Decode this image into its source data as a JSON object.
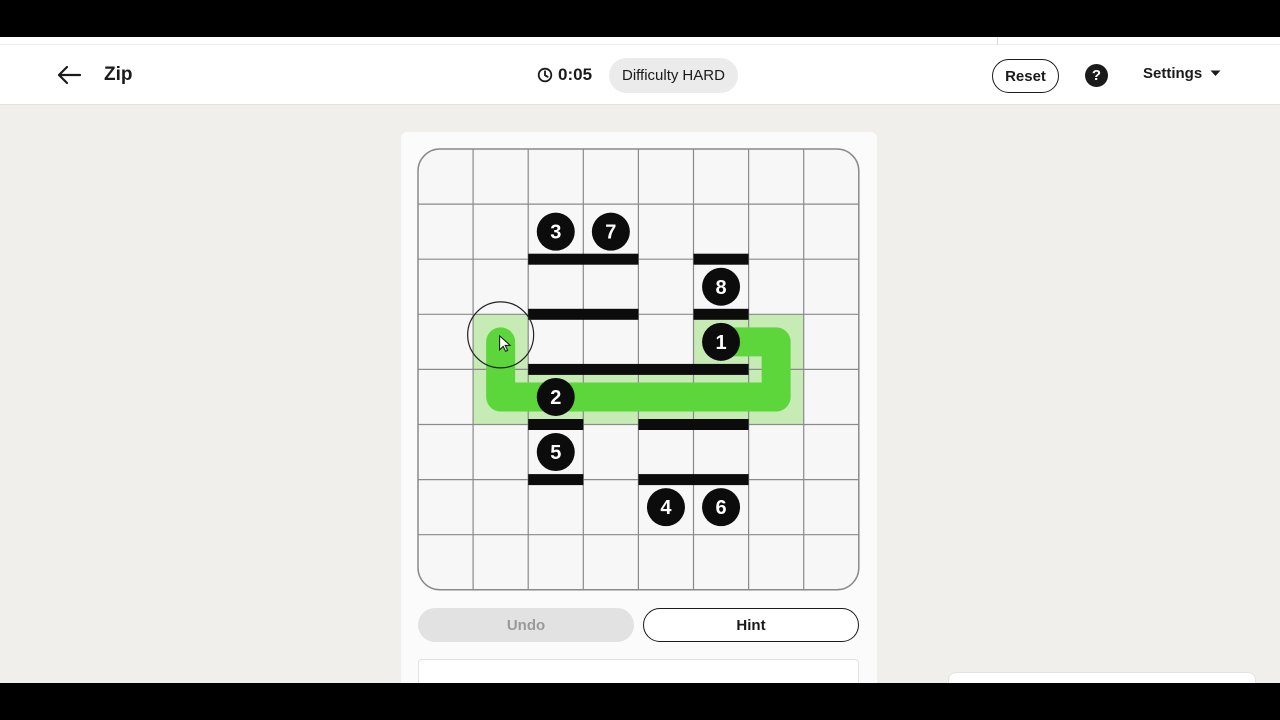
{
  "header": {
    "title": "Zip",
    "timer": "0:05",
    "difficulty_label": "Difficulty",
    "difficulty_value": "HARD",
    "reset_label": "Reset",
    "help_label": "?",
    "settings_label": "Settings"
  },
  "actions": {
    "undo_label": "Undo",
    "hint_label": "Hint"
  },
  "board": {
    "rows": 8,
    "cols": 8,
    "numbers": [
      {
        "label": "3",
        "row": 1,
        "col": 2
      },
      {
        "label": "7",
        "row": 1,
        "col": 3
      },
      {
        "label": "8",
        "row": 2,
        "col": 5
      },
      {
        "label": "1",
        "row": 3,
        "col": 5
      },
      {
        "label": "2",
        "row": 4,
        "col": 2
      },
      {
        "label": "5",
        "row": 5,
        "col": 2
      },
      {
        "label": "4",
        "row": 6,
        "col": 4
      },
      {
        "label": "6",
        "row": 6,
        "col": 5
      }
    ],
    "walls": [
      {
        "row": 2,
        "col_from": 2,
        "col_to": 3,
        "edge": "top"
      },
      {
        "row": 2,
        "col_from": 5,
        "col_to": 5,
        "edge": "top"
      },
      {
        "row": 3,
        "col_from": 2,
        "col_to": 3,
        "edge": "top"
      },
      {
        "row": 3,
        "col_from": 5,
        "col_to": 5,
        "edge": "top"
      },
      {
        "row": 4,
        "col_from": 2,
        "col_to": 5,
        "edge": "top"
      },
      {
        "row": 5,
        "col_from": 2,
        "col_to": 2,
        "edge": "top"
      },
      {
        "row": 5,
        "col_from": 4,
        "col_to": 5,
        "edge": "top"
      },
      {
        "row": 6,
        "col_from": 2,
        "col_to": 2,
        "edge": "top"
      },
      {
        "row": 6,
        "col_from": 4,
        "col_to": 5,
        "edge": "top"
      }
    ],
    "path": [
      {
        "row": 3,
        "col": 5
      },
      {
        "row": 3,
        "col": 6
      },
      {
        "row": 4,
        "col": 6
      },
      {
        "row": 4,
        "col": 5
      },
      {
        "row": 4,
        "col": 4
      },
      {
        "row": 4,
        "col": 3
      },
      {
        "row": 4,
        "col": 2
      },
      {
        "row": 4,
        "col": 1
      },
      {
        "row": 3,
        "col": 1
      }
    ],
    "colors": {
      "grid_line": "#8a8a8a",
      "cell_bg": "#f7f7f7",
      "path": "#5cd63a",
      "path_highlight": "#c6ebb4",
      "wall": "#0c0c0c",
      "number_bg": "#0c0c0c",
      "number_text": "#ffffff"
    }
  }
}
